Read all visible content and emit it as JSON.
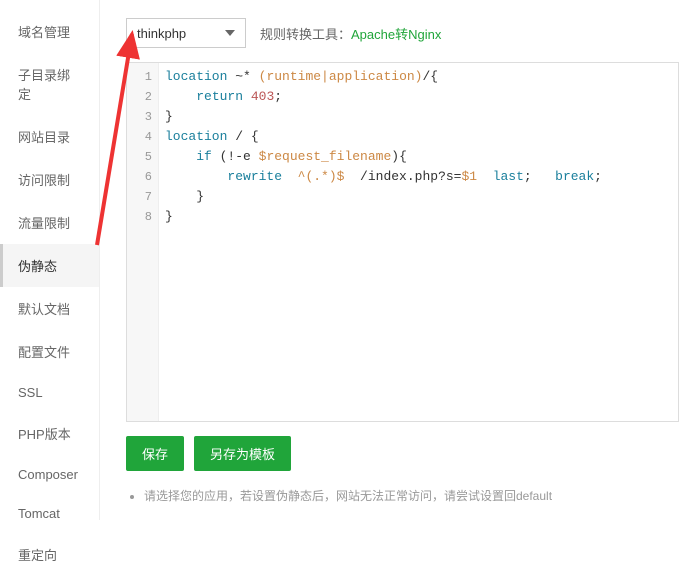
{
  "sidebar": {
    "items": [
      {
        "label": "域名管理"
      },
      {
        "label": "子目录绑定"
      },
      {
        "label": "网站目录"
      },
      {
        "label": "访问限制"
      },
      {
        "label": "流量限制"
      },
      {
        "label": "伪静态"
      },
      {
        "label": "默认文档"
      },
      {
        "label": "配置文件"
      },
      {
        "label": "SSL"
      },
      {
        "label": "PHP版本"
      },
      {
        "label": "Composer"
      },
      {
        "label": "Tomcat"
      },
      {
        "label": "重定向"
      }
    ],
    "active_index": 5
  },
  "toolbar": {
    "select_value": "thinkphp",
    "conv_label": "规则转换工具：",
    "conv_link": "Apache转Nginx"
  },
  "code": {
    "lines": [
      [
        {
          "cls": "tok-kw",
          "t": "location"
        },
        {
          "cls": "tok-plain",
          "t": " ~* "
        },
        {
          "cls": "tok-rx",
          "t": "(runtime|application)"
        },
        {
          "cls": "tok-plain",
          "t": "/{"
        }
      ],
      [
        {
          "cls": "tok-plain",
          "t": "    "
        },
        {
          "cls": "tok-kw",
          "t": "return"
        },
        {
          "cls": "tok-plain",
          "t": " "
        },
        {
          "cls": "tok-num",
          "t": "403"
        },
        {
          "cls": "tok-plain",
          "t": ";"
        }
      ],
      [
        {
          "cls": "tok-plain",
          "t": "}"
        }
      ],
      [
        {
          "cls": "tok-kw",
          "t": "location"
        },
        {
          "cls": "tok-plain",
          "t": " / {"
        }
      ],
      [
        {
          "cls": "tok-plain",
          "t": "    "
        },
        {
          "cls": "tok-kw",
          "t": "if"
        },
        {
          "cls": "tok-plain",
          "t": " (!-e "
        },
        {
          "cls": "tok-var",
          "t": "$request_filename"
        },
        {
          "cls": "tok-plain",
          "t": "){"
        }
      ],
      [
        {
          "cls": "tok-plain",
          "t": "        "
        },
        {
          "cls": "tok-kw",
          "t": "rewrite"
        },
        {
          "cls": "tok-plain",
          "t": "  "
        },
        {
          "cls": "tok-rx",
          "t": "^(.*)$"
        },
        {
          "cls": "tok-plain",
          "t": "  /index.php?s="
        },
        {
          "cls": "tok-var",
          "t": "$1"
        },
        {
          "cls": "tok-plain",
          "t": "  "
        },
        {
          "cls": "tok-kw",
          "t": "last"
        },
        {
          "cls": "tok-plain",
          "t": ";   "
        },
        {
          "cls": "tok-kw",
          "t": "break"
        },
        {
          "cls": "tok-plain",
          "t": ";"
        }
      ],
      [
        {
          "cls": "tok-plain",
          "t": "    }"
        }
      ],
      [
        {
          "cls": "tok-plain",
          "t": "}"
        }
      ]
    ]
  },
  "buttons": {
    "save": "保存",
    "save_template": "另存为模板"
  },
  "hint": "请选择您的应用，若设置伪静态后，网站无法正常访问，请尝试设置回default"
}
